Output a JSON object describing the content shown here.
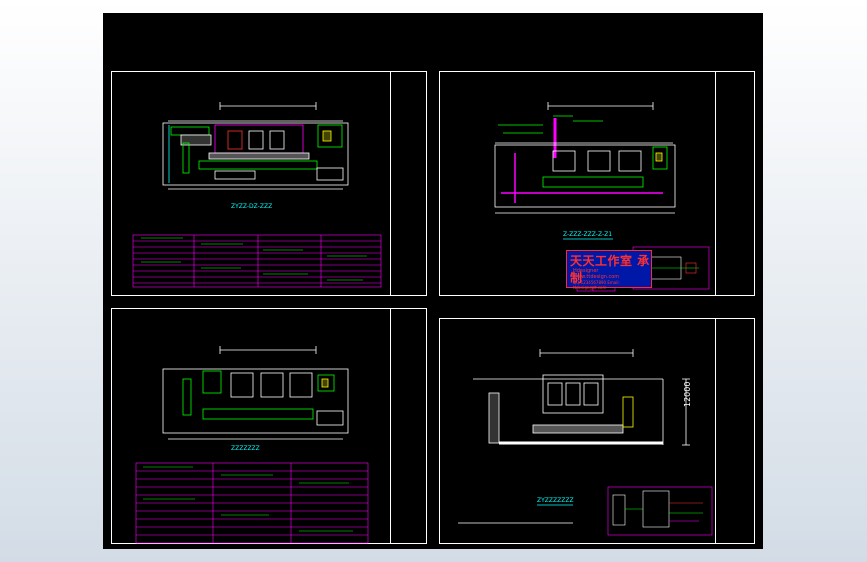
{
  "colors": {
    "background": "#000000",
    "sheet_border": "#ffffff",
    "line_magenta": "#ff00ff",
    "line_green": "#00ff00",
    "line_cyan": "#00ffff",
    "line_yellow": "#ffff00",
    "text_red": "#ff3030",
    "stamp_blue": "#0018a8"
  },
  "sheets": [
    {
      "name": "sheet-top-left",
      "caption": "ZYZZ-DZ-ZZZ"
    },
    {
      "name": "sheet-top-right",
      "caption": "Z-ZZZ-ZZZ-Z-Z1"
    },
    {
      "name": "sheet-bottom-left",
      "caption": "ZZZZZZZ"
    },
    {
      "name": "sheet-bottom-right",
      "caption": "ZYZZZZZZZ"
    }
  ],
  "stamp": {
    "title": "天天工作室 承制",
    "line1": "Hdesigner",
    "line2": "www.ttdesign.com",
    "line3": "QQ:1234567890  Email: ttdesign@tt.com"
  },
  "dimension_label": "12000"
}
